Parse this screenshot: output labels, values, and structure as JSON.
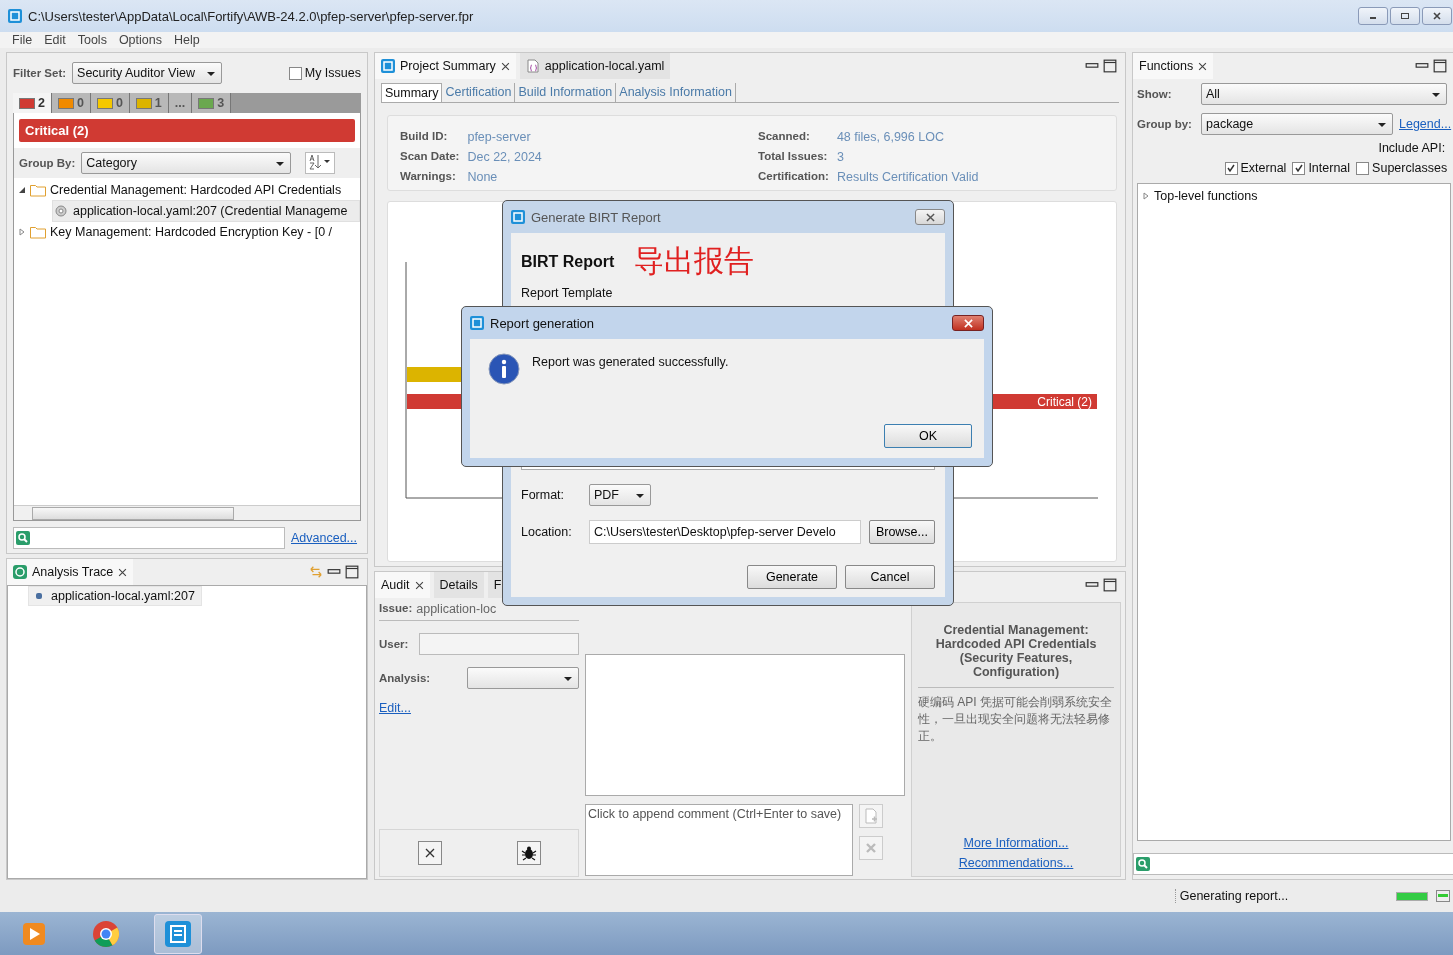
{
  "window": {
    "title": "C:\\Users\\tester\\AppData\\Local\\Fortify\\AWB-24.2.0\\pfep-server\\pfep-server.fpr"
  },
  "menu": [
    "File",
    "Edit",
    "Tools",
    "Options",
    "Help"
  ],
  "issues_panel": {
    "filter_label": "Filter Set:",
    "filter_value": "Security Auditor View",
    "my_issues": {
      "label": "My Issues",
      "checked": false
    },
    "severity_tabs": [
      {
        "count": "2",
        "color": "#d03a33",
        "selected": true
      },
      {
        "count": "0",
        "color": "#f08a00",
        "selected": false
      },
      {
        "count": "0",
        "color": "#f5c800",
        "selected": false
      },
      {
        "count": "1",
        "color": "#dcb400",
        "selected": false
      },
      {
        "count": "...",
        "selected": false
      },
      {
        "count": "3",
        "color": "#6aa84f",
        "selected": false
      }
    ],
    "banner": "Critical (2)",
    "group_label": "Group By:",
    "group_value": "Category",
    "tree": [
      {
        "label": "Credential Management: Hardcoded API Credentials",
        "expanded": true,
        "children": [
          {
            "label": "application-local.yaml:207 (Credential Manageme",
            "selected": true
          }
        ]
      },
      {
        "label": "Key Management: Hardcoded Encryption Key - [0 /",
        "expanded": false
      }
    ],
    "advanced_link": "Advanced..."
  },
  "analysis_trace": {
    "title": "Analysis Trace",
    "items": [
      "application-local.yaml:207"
    ]
  },
  "summary_panel": {
    "tabs": [
      {
        "label": "Project Summary",
        "selected": true
      },
      {
        "label": "application-local.yaml",
        "selected": false
      }
    ],
    "subtabs": [
      {
        "label": "Summary",
        "selected": true
      },
      {
        "label": "Certification",
        "selected": false
      },
      {
        "label": "Build Information",
        "selected": false
      },
      {
        "label": "Analysis Information",
        "selected": false
      }
    ],
    "fields_left": [
      {
        "label": "Build ID:",
        "value": "pfep-server"
      },
      {
        "label": "Scan Date:",
        "value": "Dec 22, 2024"
      },
      {
        "label": "Warnings:",
        "value": "None"
      }
    ],
    "fields_right": [
      {
        "label": "Scanned:",
        "value": "48 files, 6,996 LOC"
      },
      {
        "label": "Total Issues:",
        "value": "3"
      },
      {
        "label": "Certification:",
        "value": "Results Certification Valid"
      }
    ],
    "chart_label": "Critical (2)"
  },
  "audit_panel": {
    "tabs": [
      {
        "label": "Audit",
        "selected": true
      },
      {
        "label": "Details",
        "selected": false
      },
      {
        "label": "F",
        "selected": false
      }
    ],
    "issue_label": "Issue:",
    "issue_value": "application-loc",
    "user_label": "User:",
    "analysis_label": "Analysis:",
    "edit_link": "Edit...",
    "comment_placeholder": "Click to append comment (Ctrl+Enter to save)",
    "description_title": "Credential Management: Hardcoded API Credentials (Security Features, Configuration)",
    "description": "硬编码 API 凭据可能会削弱系统安全性，一旦出现安全问题将无法轻易修正。",
    "links": [
      "More Information...",
      "Recommendations..."
    ]
  },
  "functions_panel": {
    "title": "Functions",
    "show_label": "Show:",
    "show_value": "All",
    "group_label": "Group by:",
    "group_value": "package",
    "legend_link": "Legend...",
    "include_label": "Include API:",
    "options": [
      {
        "label": "External",
        "checked": true
      },
      {
        "label": "Internal",
        "checked": true
      },
      {
        "label": "Superclasses",
        "checked": false
      }
    ],
    "tree": [
      "Top-level functions"
    ]
  },
  "birt_dialog": {
    "title": "Generate BIRT Report",
    "heading": "BIRT Report",
    "annotation": "导出报告",
    "template_label": "Report Template",
    "format_label": "Format:",
    "format_value": "PDF",
    "location_label": "Location:",
    "location_value": "C:\\Users\\tester\\Desktop\\pfep-server Develo",
    "browse": "Browse...",
    "buttons": [
      "Generate",
      "Cancel"
    ]
  },
  "message_dialog": {
    "title": "Report generation",
    "message": "Report was generated successfully.",
    "button": "OK"
  },
  "status_bar": {
    "text": "Generating report...",
    "level": 1
  }
}
